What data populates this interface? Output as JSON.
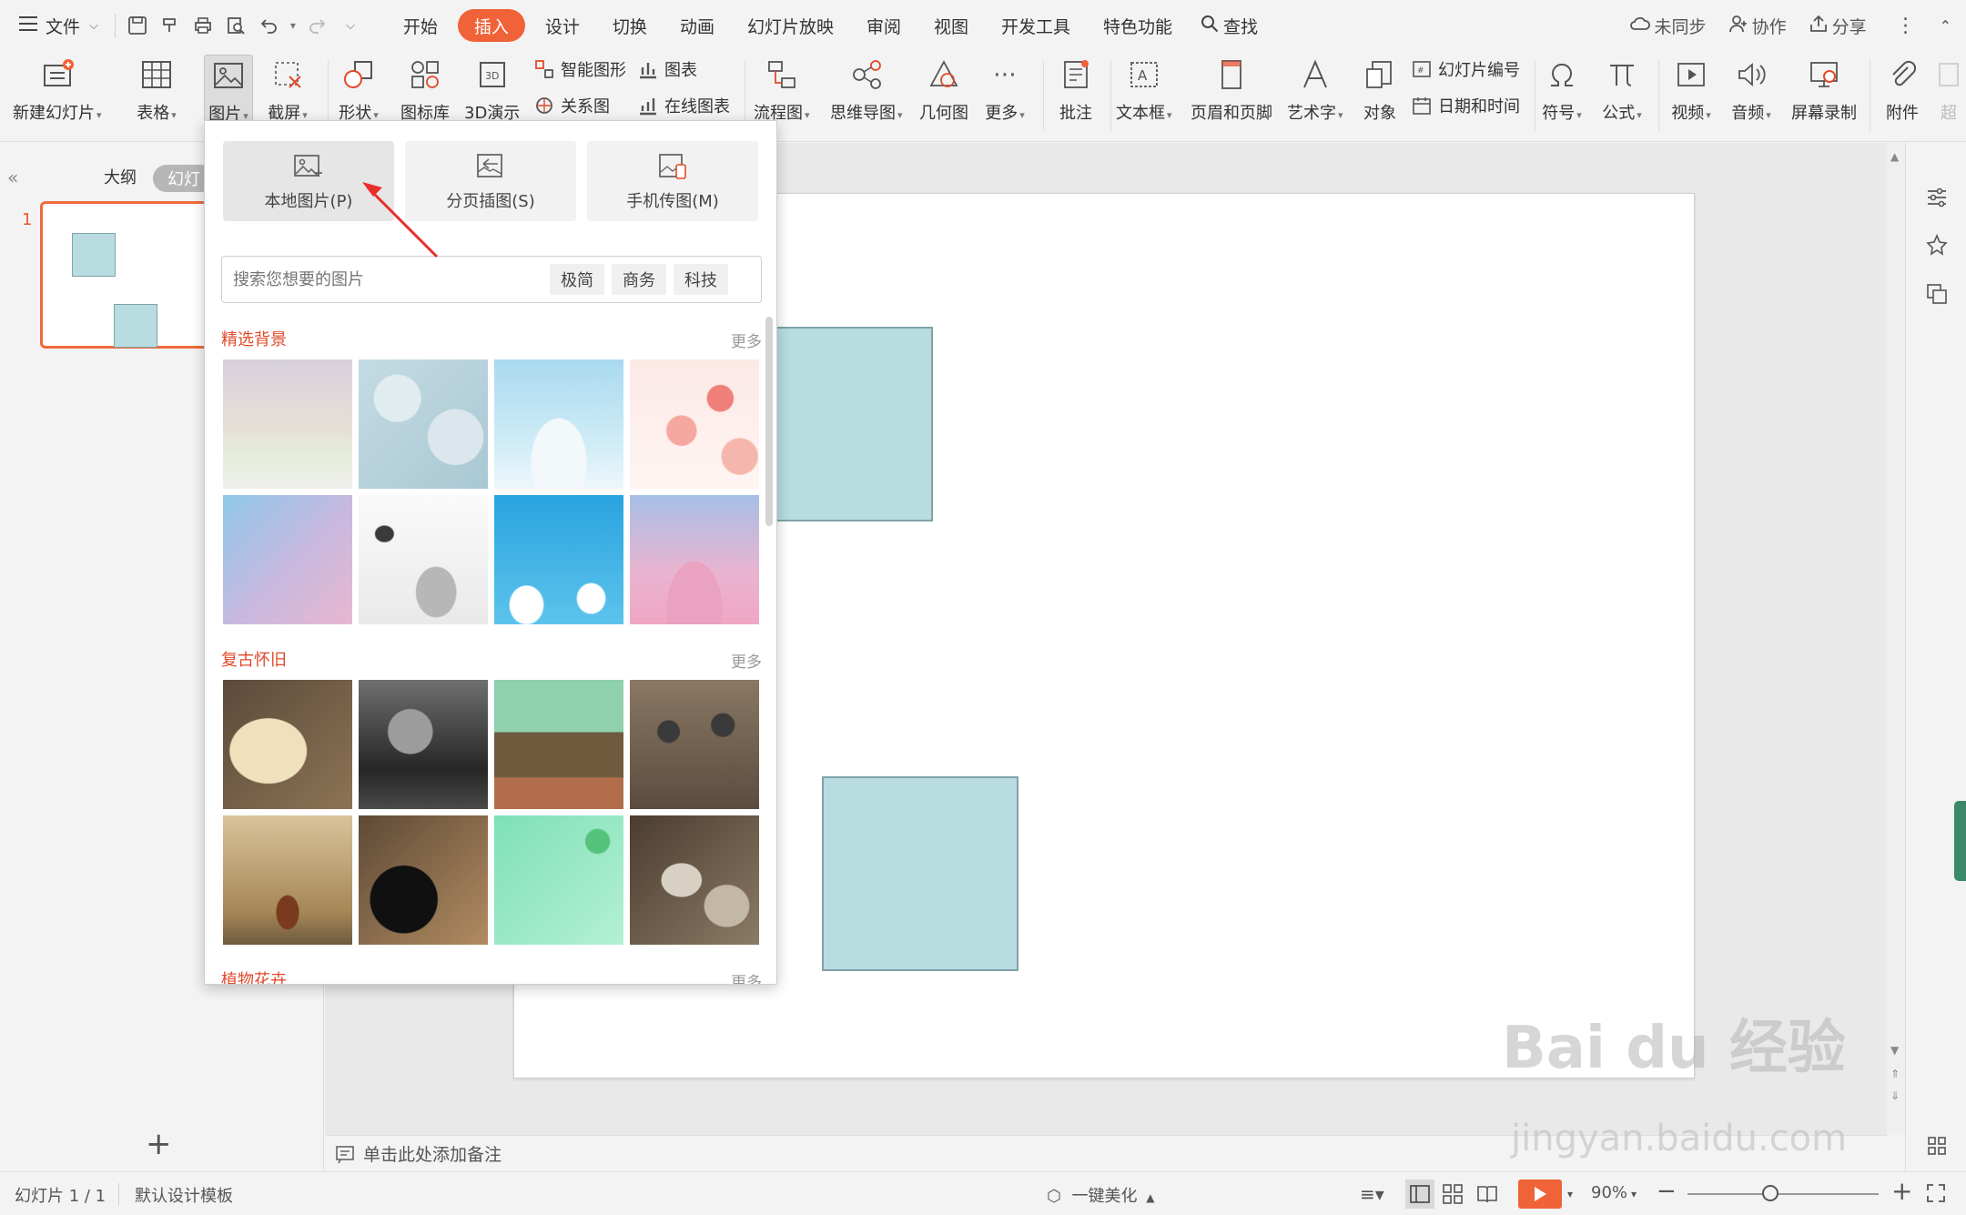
{
  "menubar": {
    "file": "文件",
    "tabs": [
      "开始",
      "插入",
      "设计",
      "切换",
      "动画",
      "幻灯片放映",
      "审阅",
      "视图",
      "开发工具",
      "特色功能"
    ],
    "active_tab": "插入",
    "search": "查找",
    "right": {
      "sync": "未同步",
      "collab": "协作",
      "share": "分享"
    }
  },
  "ribbon": {
    "new_slide": "新建幻灯片",
    "table": "表格",
    "picture": "图片",
    "screenshot": "截屏",
    "shape": "形状",
    "icon_lib": "图标库",
    "demo3d": "3D演示",
    "smart_shape": "智能图形",
    "chart": "图表",
    "relation": "关系图",
    "online_chart": "在线图表",
    "flowchart": "流程图",
    "mindmap": "思维导图",
    "geometry": "几何图",
    "more": "更多",
    "comment": "批注",
    "textbox": "文本框",
    "header_footer": "页眉和页脚",
    "wordart": "艺术字",
    "object": "对象",
    "slide_number": "幻灯片编号",
    "datetime": "日期和时间",
    "symbol": "符号",
    "formula": "公式",
    "video": "视频",
    "audio": "音频",
    "screen_record": "屏幕录制",
    "attachment": "附件",
    "overflow": "超"
  },
  "leftpanel": {
    "tab_outline": "大纲",
    "tab_slides": "幻灯",
    "slide_number": "1"
  },
  "dropdown": {
    "buttons": [
      {
        "label": "本地图片(P)"
      },
      {
        "label": "分页插图(S)"
      },
      {
        "label": "手机传图(M)"
      }
    ],
    "search_placeholder": "搜索您想要的图片",
    "tags": [
      "极简",
      "商务",
      "科技"
    ],
    "section1": {
      "title": "精选背景",
      "more": "更多"
    },
    "section2": {
      "title": "复古怀旧",
      "more": "更多"
    },
    "section3": {
      "title": "植物花卉",
      "more": "更多"
    }
  },
  "notes": {
    "placeholder": "单击此处添加备注"
  },
  "statusbar": {
    "slide_info": "幻灯片 1 / 1",
    "template": "默认设计模板",
    "beautify": "一键美化",
    "zoom": "90%"
  },
  "watermark": {
    "brand": "Bai du 经验",
    "url": "jingyan.baidu.com"
  },
  "colors": {
    "accent": "#f06237",
    "shape_fill": "#b8dcdf",
    "shape_border": "#7fa3a6",
    "section_title": "#e04a2a"
  }
}
